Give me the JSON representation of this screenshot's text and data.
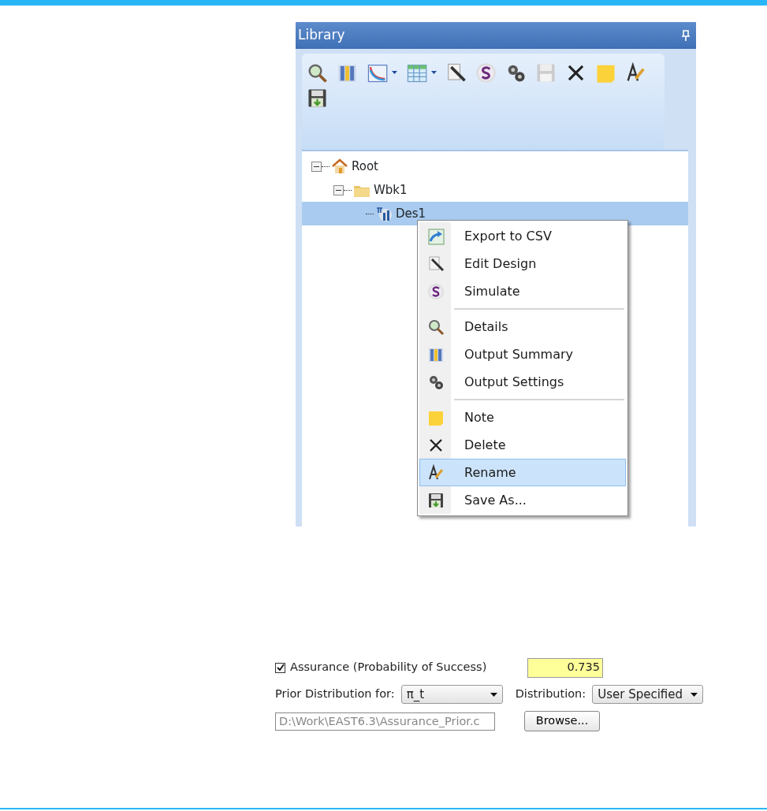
{
  "library": {
    "title": "Library",
    "toolbar": [
      {
        "kind": "details"
      },
      {
        "kind": "summary"
      },
      {
        "kind": "chart"
      },
      {
        "kind": "dropdown"
      },
      {
        "kind": "table"
      },
      {
        "kind": "dropdown"
      },
      {
        "kind": "edit"
      },
      {
        "kind": "simulate"
      },
      {
        "kind": "settings"
      },
      {
        "kind": "save"
      },
      {
        "kind": "delete"
      },
      {
        "kind": "note"
      },
      {
        "kind": "rename"
      },
      {
        "kind": "saveas"
      }
    ],
    "tree": [
      {
        "label": "Root",
        "kind": "home",
        "expanded": true,
        "selected": false,
        "children": [
          {
            "label": "Wbk1",
            "kind": "folder",
            "expanded": true,
            "selected": false,
            "children": [
              {
                "label": "Des1",
                "kind": "design",
                "selected": true
              }
            ]
          }
        ]
      }
    ]
  },
  "context_menu": {
    "groups": [
      [
        {
          "label": "Export to CSV",
          "kind": "export",
          "selected": false
        },
        {
          "label": "Edit Design",
          "kind": "edit",
          "selected": false
        },
        {
          "label": "Simulate",
          "kind": "simulate",
          "selected": false
        }
      ],
      [
        {
          "label": "Details",
          "kind": "details",
          "selected": false
        },
        {
          "label": "Output Summary",
          "kind": "summary",
          "selected": false
        },
        {
          "label": "Output Settings",
          "kind": "settings",
          "selected": false
        }
      ],
      [
        {
          "label": "Note",
          "kind": "note",
          "selected": false
        },
        {
          "label": "Delete",
          "kind": "delete",
          "selected": false
        },
        {
          "label": "Rename",
          "kind": "rename",
          "selected": true
        },
        {
          "label": "Save As...",
          "kind": "saveas",
          "selected": false
        }
      ]
    ]
  },
  "assurance": {
    "label": "Assurance (Probability of Success)",
    "checked": true,
    "value": "0.735",
    "prior_label": "Prior Distribution for:",
    "prior_value": "π_t",
    "distribution_label": "Distribution:",
    "distribution_value": "User Specified",
    "file_path": "D:\\Work\\EAST6.3\\Assurance_Prior.c",
    "browse_button": "Browse..."
  }
}
